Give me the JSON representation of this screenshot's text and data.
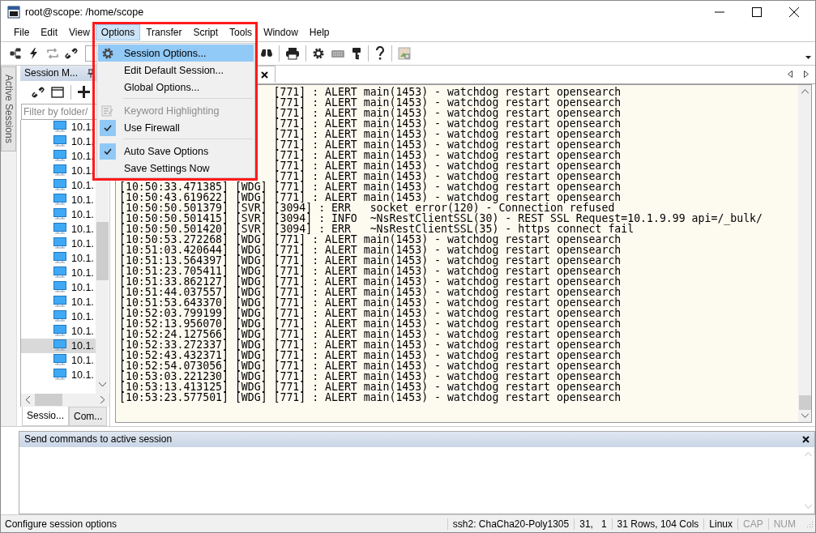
{
  "window": {
    "title": "root@scope: /home/scope"
  },
  "menu_bar": [
    {
      "label": "File",
      "selected": false
    },
    {
      "label": "Edit",
      "selected": false
    },
    {
      "label": "View",
      "selected": false
    },
    {
      "label": "Options",
      "selected": true
    },
    {
      "label": "Transfer",
      "selected": false
    },
    {
      "label": "Script",
      "selected": false
    },
    {
      "label": "Tools",
      "selected": false
    },
    {
      "label": "Window",
      "selected": false
    },
    {
      "label": "Help",
      "selected": false
    }
  ],
  "options_menu": [
    {
      "kind": "gear",
      "label": "Session Options...",
      "selected": true,
      "disabled": false,
      "checked": false
    },
    {
      "kind": "plain",
      "label": "Edit Default Session...",
      "selected": false,
      "disabled": false,
      "checked": false
    },
    {
      "kind": "plain",
      "label": "Global Options...",
      "selected": false,
      "disabled": false,
      "checked": false
    },
    {
      "kind": "separator"
    },
    {
      "kind": "note",
      "label": "Keyword Highlighting",
      "selected": false,
      "disabled": true,
      "checked": false
    },
    {
      "kind": "plain",
      "label": "Use Firewall",
      "selected": false,
      "disabled": false,
      "checked": true
    },
    {
      "kind": "separator"
    },
    {
      "kind": "plain",
      "label": "Auto Save Options",
      "selected": false,
      "disabled": false,
      "checked": true
    },
    {
      "kind": "plain",
      "label": "Save Settings Now",
      "selected": false,
      "disabled": false,
      "checked": false
    }
  ],
  "side_tab": {
    "label": "Active Sessions"
  },
  "session_manager": {
    "title": "Session M...",
    "filter": {
      "placeholder": "Filter by folder/"
    },
    "items": [
      {
        "label": "10.1.",
        "selected": false
      },
      {
        "label": "10.1.",
        "selected": false
      },
      {
        "label": "10.1.",
        "selected": false
      },
      {
        "label": "10.1.",
        "selected": false
      },
      {
        "label": "10.1.",
        "selected": false
      },
      {
        "label": "10.1.",
        "selected": false
      },
      {
        "label": "10.1.",
        "selected": false
      },
      {
        "label": "10.1.",
        "selected": false
      },
      {
        "label": "10.1.",
        "selected": false
      },
      {
        "label": "10.1.",
        "selected": false
      },
      {
        "label": "10.1.",
        "selected": false
      },
      {
        "label": "10.1.",
        "selected": false
      },
      {
        "label": "10.1.",
        "selected": false
      },
      {
        "label": "10.1.",
        "selected": false
      },
      {
        "label": "10.1.",
        "selected": false
      },
      {
        "label": "10.1.",
        "selected": true
      },
      {
        "label": "10.1.",
        "selected": false
      },
      {
        "label": "10.1.",
        "selected": false
      }
    ],
    "tabs": [
      {
        "label": "Sessio...",
        "selected": true
      },
      {
        "label": "Com...",
        "selected": false
      }
    ]
  },
  "terminal": {
    "lines": [
      {
        "kind": "partial",
        "text": "[771] : ALERT main(1453) - watchdog restart opensearch"
      },
      {
        "kind": "partial",
        "text": "[771] : ALERT main(1453) - watchdog restart opensearch"
      },
      {
        "kind": "partial",
        "text": "[771] : ALERT main(1453) - watchdog restart opensearch"
      },
      {
        "kind": "partial",
        "text": "[771] : ALERT main(1453) - watchdog restart opensearch"
      },
      {
        "kind": "partial",
        "text": "[771] : ALERT main(1453) - watchdog restart opensearch"
      },
      {
        "kind": "partial",
        "text": "[771] : ALERT main(1453) - watchdog restart opensearch"
      },
      {
        "kind": "partial",
        "text": "[771] : ALERT main(1453) - watchdog restart opensearch"
      },
      {
        "kind": "partial",
        "text": "[771] : ALERT main(1453) - watchdog restart opensearch"
      },
      {
        "kind": "partial",
        "text": "[771] : ALERT main(1453) - watchdog restart opensearch"
      },
      {
        "kind": "full",
        "text": "[10:50:33.471385] [WDG] [771] : ALERT main(1453) - watchdog restart opensearch"
      },
      {
        "kind": "full",
        "text": "[10:50:43.619622] [WDG] [771] : ALERT main(1453) - watchdog restart opensearch"
      },
      {
        "kind": "full",
        "text": "[10:50:50.501379] [SVR] [3094] : ERR   socket_error(120) - Connection refused"
      },
      {
        "kind": "full",
        "text": "[10:50:50.501415] [SVR] [3094] : INFO  ~NsRestClientSSL(30) - REST SSL Request=10.1.9.99 api=/_bulk/"
      },
      {
        "kind": "full",
        "text": "[10:50:50.501420] [SVR] [3094] : ERR   ~NsRestClientSSL(35) - https connect fail"
      },
      {
        "kind": "full",
        "text": "[10:50:53.272268] [WDG] [771] : ALERT main(1453) - watchdog restart opensearch"
      },
      {
        "kind": "full",
        "text": "[10:51:03.420644] [WDG] [771] : ALERT main(1453) - watchdog restart opensearch"
      },
      {
        "kind": "full",
        "text": "[10:51:13.564397] [WDG] [771] : ALERT main(1453) - watchdog restart opensearch"
      },
      {
        "kind": "full",
        "text": "[10:51:23.705411] [WDG] [771] : ALERT main(1453) - watchdog restart opensearch"
      },
      {
        "kind": "full",
        "text": "[10:51:33.862127] [WDG] [771] : ALERT main(1453) - watchdog restart opensearch"
      },
      {
        "kind": "full",
        "text": "[10:51:44.037557] [WDG] [771] : ALERT main(1453) - watchdog restart opensearch"
      },
      {
        "kind": "full",
        "text": "[10:51:53.643370] [WDG] [771] : ALERT main(1453) - watchdog restart opensearch"
      },
      {
        "kind": "full",
        "text": "[10:52:03.799199] [WDG] [771] : ALERT main(1453) - watchdog restart opensearch"
      },
      {
        "kind": "full",
        "text": "[10:52:13.956070] [WDG] [771] : ALERT main(1453) - watchdog restart opensearch"
      },
      {
        "kind": "full",
        "text": "[10:52:24.127566] [WDG] [771] : ALERT main(1453) - watchdog restart opensearch"
      },
      {
        "kind": "full",
        "text": "[10:52:33.272337] [WDG] [771] : ALERT main(1453) - watchdog restart opensearch"
      },
      {
        "kind": "full",
        "text": "[10:52:43.432371] [WDG] [771] : ALERT main(1453) - watchdog restart opensearch"
      },
      {
        "kind": "full",
        "text": "[10:52:54.073056] [WDG] [771] : ALERT main(1453) - watchdog restart opensearch"
      },
      {
        "kind": "full",
        "text": "[10:53:03.221230] [WDG] [771] : ALERT main(1453) - watchdog restart opensearch"
      },
      {
        "kind": "full",
        "text": "[10:53:13.413125] [WDG] [771] : ALERT main(1453) - watchdog restart opensearch"
      },
      {
        "kind": "full",
        "text": "[10:53:23.577501] [WDG] [771] : ALERT main(1453) - watchdog restart opensearch"
      }
    ]
  },
  "command_panel": {
    "title": "Send commands to active session"
  },
  "status_bar": {
    "message": "Configure session options",
    "panes": [
      {
        "text": "ssh2: ChaCha20-Poly1305",
        "disabled": false
      },
      {
        "text": "31,   1",
        "disabled": false
      },
      {
        "text": "31 Rows, 104 Cols",
        "disabled": false
      },
      {
        "text": "Linux",
        "disabled": false
      },
      {
        "text": "CAP",
        "disabled": true
      },
      {
        "text": "NUM",
        "disabled": true
      }
    ]
  }
}
